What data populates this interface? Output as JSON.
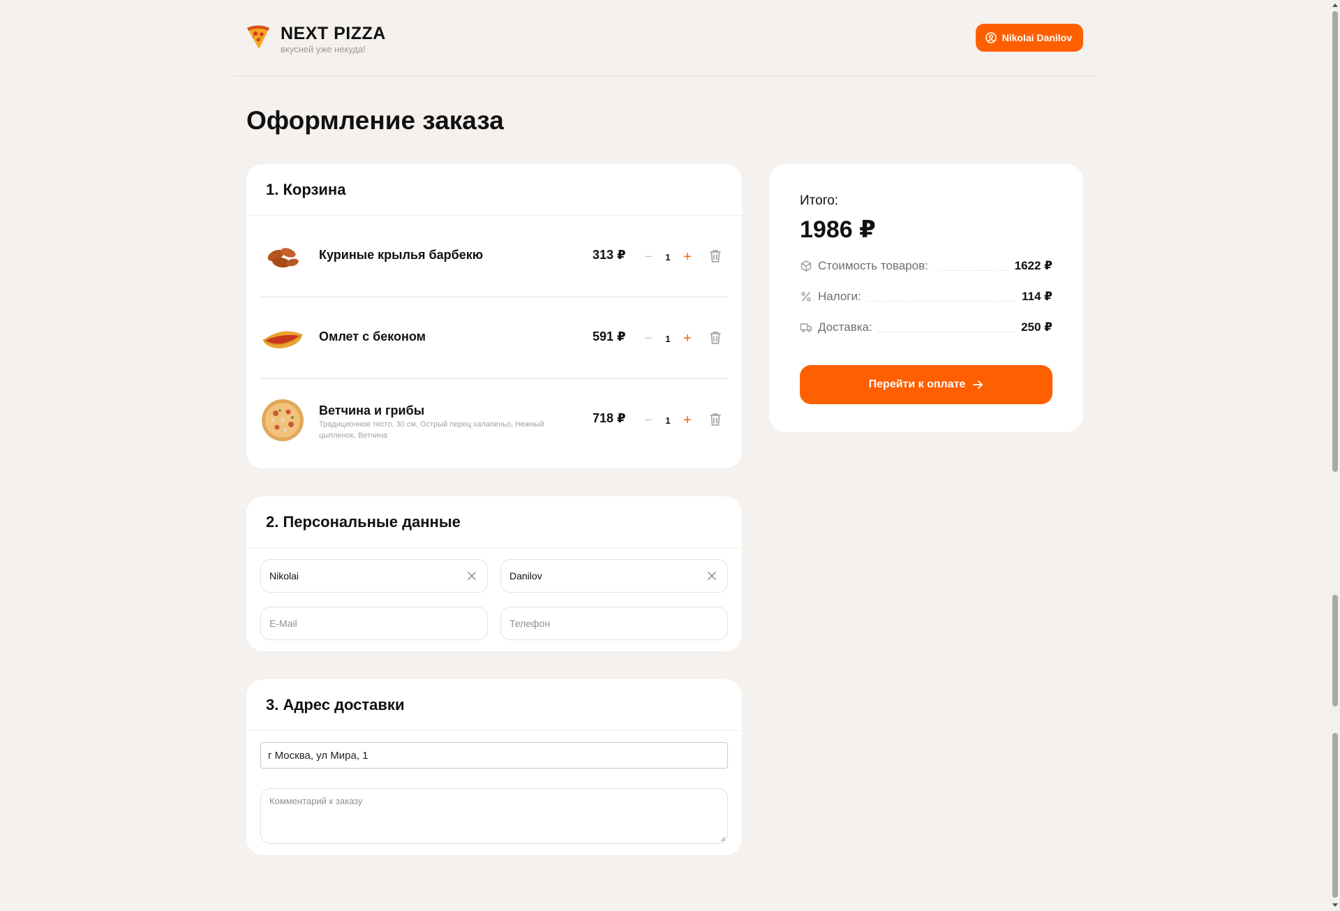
{
  "brand": {
    "name": "NEXT PIZZA",
    "tagline": "вкусней уже некуда!"
  },
  "user": {
    "name": "Nikolai Danilov"
  },
  "page": {
    "title": "Оформление заказа"
  },
  "cart": {
    "title": "1. Корзина",
    "items": [
      {
        "name": "Куриные крылья барбекю",
        "description": "",
        "price": "313 ₽",
        "qty": "1",
        "image": "chicken-wings"
      },
      {
        "name": "Омлет с беконом",
        "description": "",
        "price": "591 ₽",
        "qty": "1",
        "image": "omelette"
      },
      {
        "name": "Ветчина и грибы",
        "description": "Традиционное тесто, 30 см, Острый перец халапеньо, Нежный цыпленок, Ветчина",
        "price": "718 ₽",
        "qty": "1",
        "image": "pizza"
      }
    ]
  },
  "personal": {
    "title": "2. Персональные данные",
    "first_name": "Nikolai",
    "last_name": "Danilov",
    "email_placeholder": "E-Mail",
    "phone_placeholder": "Телефон"
  },
  "address": {
    "title": "3. Адрес доставки",
    "value": "г Москва, ул Мира, 1",
    "comment_placeholder": "Комментарий к заказу"
  },
  "summary": {
    "label": "Итого:",
    "total": "1986 ₽",
    "rows": [
      {
        "label": "Стоимость товаров:",
        "value": "1622 ₽",
        "icon": "package-icon"
      },
      {
        "label": "Налоги:",
        "value": "114 ₽",
        "icon": "percent-icon"
      },
      {
        "label": "Доставка:",
        "value": "250 ₽",
        "icon": "truck-icon"
      }
    ],
    "pay_label": "Перейти к оплате"
  },
  "colors": {
    "accent": "#fe5f00",
    "background": "#f4f1ee",
    "card": "#ffffff"
  }
}
